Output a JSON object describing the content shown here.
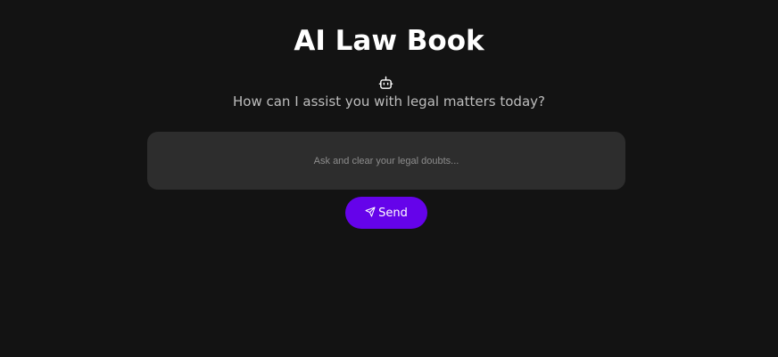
{
  "header": {
    "title": "AI Law Book",
    "icon": "robot-icon",
    "subtitle": "How can I assist you with legal matters today?"
  },
  "chat": {
    "input_value": "",
    "input_placeholder": "Ask and clear your legal doubts...",
    "send_label": "Send",
    "send_icon": "send-icon"
  },
  "colors": {
    "background": "#131313",
    "input_background": "#2d2d2d",
    "accent": "#6503ea",
    "title_text": "#ffffff",
    "subtitle_text": "#bdbdbd"
  }
}
